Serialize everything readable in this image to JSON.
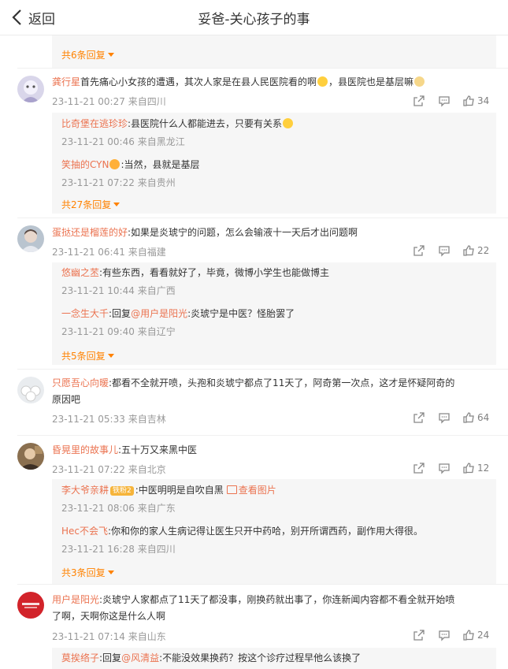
{
  "header": {
    "back_label": "返回",
    "title": "妥爸-关心孩子的事"
  },
  "top_partial": {
    "more": "共6条回复"
  },
  "comments": [
    {
      "username": "龚行星",
      "text_before": "首先痛心小女孩的遭遇，其次人家是在县人民医院看的啊",
      "text_after": "，县医院也是基层嘛",
      "date": "23-11-21 00:27",
      "location": "来自四川",
      "likes": "34",
      "replies": [
        {
          "username": "比奇堡在逃珍珍",
          "text": ":县医院什么人都能进去，只要有关系",
          "date": "23-11-21 00:46",
          "location": "来自黑龙江"
        },
        {
          "username": "笑抽的CYN",
          "text": ":当然，县就是基层",
          "date": "23-11-21 07:22",
          "location": "来自贵州"
        }
      ],
      "more": "共27条回复"
    },
    {
      "username": "蛋挞还是榴莲的好",
      "text": ":如果是炎琥宁的问题，怎么会输液十一天后才出问题啊",
      "date": "23-11-21 06:41",
      "location": "来自福建",
      "likes": "22",
      "replies": [
        {
          "username": "悠幽之苤",
          "text": ":有些东西，看看就好了，毕竟，微博小学生也能做博主",
          "date": "23-11-21 10:44",
          "location": "来自广西"
        },
        {
          "username": "一念生大千",
          "reply_word": ":回复",
          "mention": "@用户是阳光",
          "text": ":炎琥宁是中医？怪胎罢了",
          "date": "23-11-21 09:40",
          "location": "来自辽宁"
        }
      ],
      "more": "共5条回复"
    },
    {
      "username": "只愿吾心向暖",
      "text_line1": ":都看不全就开喷，头孢和炎琥宁都点了11天了，阿奇第一次点，这才是怀疑阿奇的",
      "text_line2": "原因吧",
      "date": "23-11-21 05:33",
      "location": "来自吉林",
      "likes": "64"
    },
    {
      "username": "昏晃里的故事儿",
      "text": ":五十万又来黑中医",
      "date": "23-11-21 07:22",
      "location": "来自北京",
      "likes": "12",
      "replies": [
        {
          "username": "李大爷亲耕",
          "badge": "铁粉2",
          "text": ":中医明明是自吹自黑",
          "link": "查看图片",
          "date": "23-11-21 08:06",
          "location": "来自广东"
        },
        {
          "username": "Hec不会飞",
          "text": ":你和你的家人生病记得让医生只开中药哈，别开所谓西药，副作用大得很。",
          "date": "23-11-21 16:28",
          "location": "来自四川"
        }
      ],
      "more": "共3条回复"
    },
    {
      "username": "用户是阳光",
      "text_line1": ":炎琥宁人家都点了11天了都没事，刚换药就出事了，你连新闻内容都不看全就开始喷",
      "text_line2": "了啊，天啊你这是什么人啊",
      "date": "23-11-21 07:14",
      "location": "来自山东",
      "likes": "24",
      "replies": [
        {
          "username": "莫挨络子",
          "reply_word": ":回复",
          "mention": "@风清益",
          "text": ":不能没效果换药？按这个诊疗过程早他么该换了"
        }
      ]
    }
  ],
  "colors": {
    "accent": "#ff8200",
    "username": "#eb7350",
    "meta": "#999999",
    "reply_bg": "#f6f6f6"
  },
  "icons": [
    "back-chevron-icon",
    "share-icon",
    "comment-icon",
    "like-icon",
    "emoji-icon",
    "fan-badge-icon",
    "image-icon"
  ]
}
